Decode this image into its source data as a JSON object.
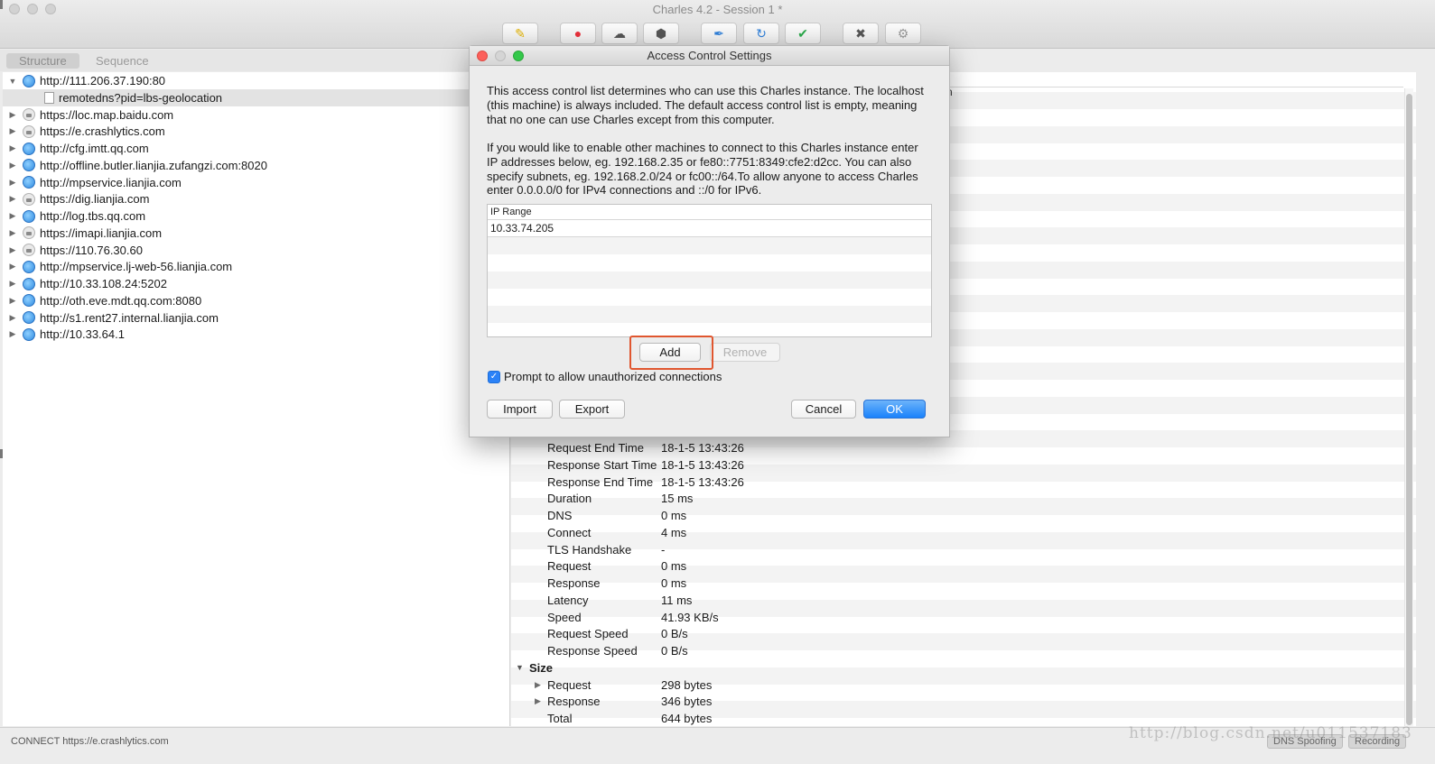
{
  "window": {
    "title": "Charles 4.2 - Session 1 *"
  },
  "toolbar": {
    "buttons": [
      {
        "name": "broom-icon",
        "glyph": "✎",
        "color": "#e0b100"
      },
      {
        "name": "record-icon",
        "glyph": "●",
        "color": "#e8313c"
      },
      {
        "name": "throttle-turtle-icon",
        "glyph": "☁",
        "color": "#555555"
      },
      {
        "name": "breakpoint-stop-icon",
        "glyph": "⬢",
        "color": "#555555"
      },
      {
        "name": "compose-pen-icon",
        "glyph": "✒",
        "color": "#2f7fd8"
      },
      {
        "name": "repeat-icon",
        "glyph": "↻",
        "color": "#2f7fd8"
      },
      {
        "name": "validate-check-icon",
        "glyph": "✔",
        "color": "#2aa84a"
      },
      {
        "name": "tools-icon",
        "glyph": "✖",
        "color": "#555555"
      },
      {
        "name": "settings-gear-icon",
        "glyph": "⚙",
        "color": "#999999"
      }
    ]
  },
  "tabs": {
    "structure": "Structure",
    "sequence": "Sequence"
  },
  "tree": {
    "items": [
      {
        "label": "http://111.206.37.190:80",
        "type": "http",
        "expanded": true
      },
      {
        "label": "remotedns?pid=lbs-geolocation",
        "type": "file",
        "selected": true
      },
      {
        "label": "https://loc.map.baidu.com",
        "type": "https"
      },
      {
        "label": "https://e.crashlytics.com",
        "type": "https"
      },
      {
        "label": "http://cfg.imtt.qq.com",
        "type": "http"
      },
      {
        "label": "http://offline.butler.lianjia.zufangzi.com:8020",
        "type": "http"
      },
      {
        "label": "http://mpservice.lianjia.com",
        "type": "http"
      },
      {
        "label": "https://dig.lianjia.com",
        "type": "https"
      },
      {
        "label": "http://log.tbs.qq.com",
        "type": "http"
      },
      {
        "label": "https://imapi.lianjia.com",
        "type": "https"
      },
      {
        "label": "https://110.76.30.60",
        "type": "https"
      },
      {
        "label": "http://mpservice.lj-web-56.lianjia.com",
        "type": "http"
      },
      {
        "label": "http://10.33.108.24:5202",
        "type": "http"
      },
      {
        "label": "http://oth.eve.mdt.qq.com:8080",
        "type": "http"
      },
      {
        "label": "http://s1.rent27.internal.lianjia.com",
        "type": "http"
      },
      {
        "label": "http://10.33.64.1",
        "type": "http"
      }
    ]
  },
  "overview": {
    "header_fragment": "n",
    "rows": [
      {
        "label": "Request End Time",
        "value": "18-1-5 13:43:26"
      },
      {
        "label": "Response Start Time",
        "value": "18-1-5 13:43:26"
      },
      {
        "label": "Response End Time",
        "value": "18-1-5 13:43:26"
      },
      {
        "label": "Duration",
        "value": "15 ms"
      },
      {
        "label": "DNS",
        "value": "0 ms"
      },
      {
        "label": "Connect",
        "value": "4 ms"
      },
      {
        "label": "TLS Handshake",
        "value": "-"
      },
      {
        "label": "Request",
        "value": "0 ms"
      },
      {
        "label": "Response",
        "value": "0 ms"
      },
      {
        "label": "Latency",
        "value": "11 ms"
      },
      {
        "label": "Speed",
        "value": "41.93 KB/s"
      },
      {
        "label": "Request Speed",
        "value": "0 B/s"
      },
      {
        "label": "Response Speed",
        "value": "0 B/s"
      }
    ],
    "size_section": "Size",
    "size_rows": [
      {
        "label": "Request",
        "value": "298 bytes",
        "expandable": true
      },
      {
        "label": "Response",
        "value": "346 bytes",
        "expandable": true
      },
      {
        "label": "Total",
        "value": "644 bytes",
        "expandable": false
      }
    ]
  },
  "dialog": {
    "title": "Access Control Settings",
    "para1": "This access control list determines who can use this Charles instance. The localhost (this machine) is always included. The default access control list is empty, meaning that no one can use Charles except from this computer.",
    "para2": "If you would like to enable other machines to connect to this Charles instance enter IP addresses below, eg. 192.168.2.35 or fe80::7751:8349:cfe2:d2cc. You can also specify subnets, eg. 192.168.2.0/24 or fc00::/64.To allow anyone to access Charles enter 0.0.0.0/0 for IPv4 connections and ::/0 for IPv6.",
    "table_header": "IP Range",
    "ip_ranges": [
      "10.33.74.205"
    ],
    "add_label": "Add",
    "remove_label": "Remove",
    "checkbox_label": "Prompt to allow unauthorized connections",
    "checkbox_checked": true,
    "import_label": "Import",
    "export_label": "Export",
    "cancel_label": "Cancel",
    "ok_label": "OK"
  },
  "statusbar": {
    "text": "CONNECT https://e.crashlytics.com",
    "dns_spoofing": "DNS Spoofing",
    "recording": "Recording"
  },
  "watermark": "http://blog.csdn.net/u011537183"
}
